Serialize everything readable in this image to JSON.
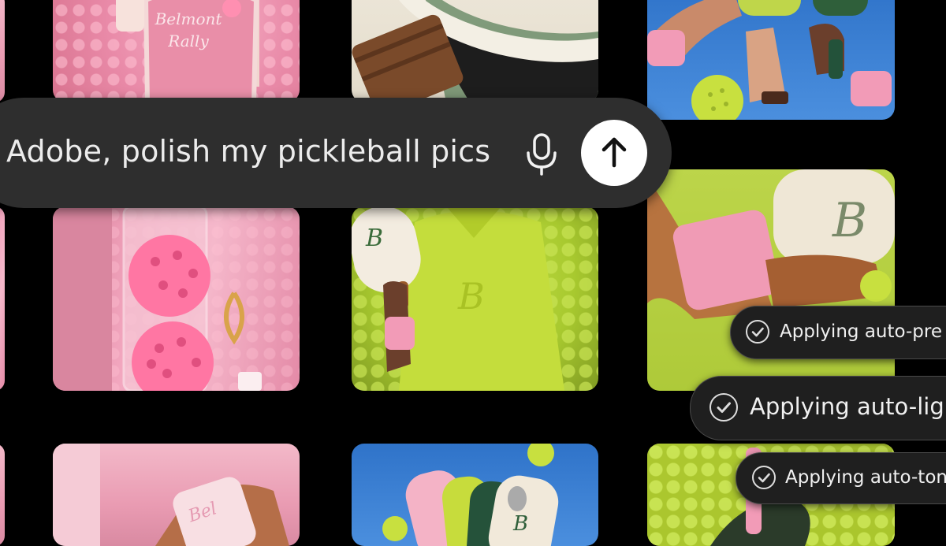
{
  "prompt": {
    "text": "Adobe, polish my pickleball pics"
  },
  "icons": {
    "mic": "microphone-icon",
    "send": "arrow-up-icon",
    "check": "check-circle-icon"
  },
  "status_items": [
    {
      "label": "Applying auto-pre"
    },
    {
      "label": "Applying auto-lig"
    },
    {
      "label": "Applying auto-ton"
    }
  ],
  "photos": {
    "bag_lettering": "Belmont Rally"
  },
  "colors": {
    "prompt_bg": "#2e2e2e",
    "send_bg": "#ffffff",
    "status_bg": "#1f1f1f",
    "pink": "#f2a7bf",
    "lime": "#c5e34a"
  }
}
